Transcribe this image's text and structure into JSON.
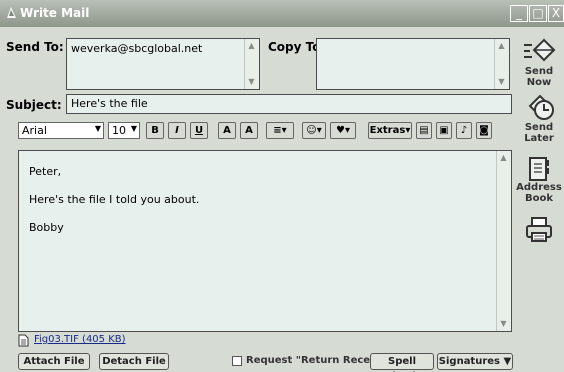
{
  "window": {
    "title": "Write Mail",
    "controls": {
      "minimize": "_",
      "maximize": "□",
      "close": "X"
    }
  },
  "header": {
    "send_to_label": "Send To:",
    "send_to_value": "weverka@sbcglobal.net",
    "copy_to_label": "Copy To:",
    "copy_to_value": "",
    "subject_label": "Subject:",
    "subject_value": "Here's the file"
  },
  "formatting": {
    "font": "Arial",
    "size": "10",
    "bold": "B",
    "italic": "I",
    "underline": "U",
    "text_color": "A",
    "background_color": "A",
    "extras": "Extras"
  },
  "body": {
    "lines": [
      "Peter,",
      "Here's the file I told you about.",
      "Bobby"
    ]
  },
  "attachment": {
    "name": "Fig03.TIF (405 KB)"
  },
  "bottom": {
    "attach": "Attach File",
    "detach": "Detach File",
    "return_receipt": "Request \"Return Receipt\"",
    "spell_check": "Spell Check",
    "signatures": "Signatures"
  },
  "sidebar": {
    "send_now": "Send Now",
    "send_later": "Send Later",
    "address_book": [
      "Address",
      "Book"
    ],
    "print": ""
  },
  "colors": {
    "window_bg": "#d6dcd4",
    "field_bg": "#e7f0ec",
    "title_bg": "#8e968c",
    "link": "#1a2a8a"
  }
}
